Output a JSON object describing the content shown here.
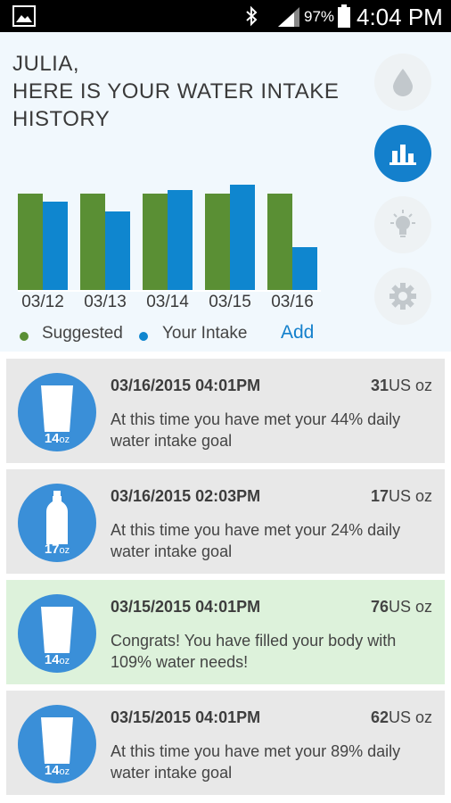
{
  "status_bar": {
    "battery": "97%",
    "time": "4:04 PM"
  },
  "header": {
    "title_line1": "JULIA,",
    "title_line2": "HERE IS YOUR WATER INTAKE",
    "title_line3": "HISTORY"
  },
  "side_nav": [
    {
      "icon": "water-drop-icon",
      "active": false
    },
    {
      "icon": "bar-chart-icon",
      "active": true
    },
    {
      "icon": "lightbulb-icon",
      "active": false
    },
    {
      "icon": "gear-icon",
      "active": false
    }
  ],
  "legend": {
    "suggested": "Suggested",
    "intake": "Your Intake",
    "add": "Add"
  },
  "colors": {
    "suggested": "#5a8f34",
    "intake": "#0f86cf",
    "accent": "#1480cc"
  },
  "chart_data": {
    "type": "bar",
    "categories": [
      "03/12",
      "03/13",
      "03/14",
      "03/15",
      "03/16"
    ],
    "series": [
      {
        "name": "Suggested",
        "values": [
          70,
          70,
          70,
          70,
          70
        ]
      },
      {
        "name": "Your Intake",
        "values": [
          64,
          57,
          72,
          76,
          31
        ]
      }
    ]
  },
  "entries": [
    {
      "date": "03/16/2015 04:01PM",
      "amount": "31",
      "unit": "US oz",
      "oz": "14",
      "oz_unit": "oz",
      "vessel": "glass-icon",
      "message": "At this time you have met your 44% daily water intake goal",
      "highlight": false
    },
    {
      "date": "03/16/2015 02:03PM",
      "amount": "17",
      "unit": "US oz",
      "oz": "17",
      "oz_unit": "oz",
      "vessel": "bottle-icon",
      "message": "At this time you have met your 24% daily water intake goal",
      "highlight": false
    },
    {
      "date": "03/15/2015 04:01PM",
      "amount": "76",
      "unit": "US oz",
      "oz": "14",
      "oz_unit": "oz",
      "vessel": "glass-icon",
      "message": "Congrats! You have filled your body with 109% water needs!",
      "highlight": true
    },
    {
      "date": "03/15/2015 04:01PM",
      "amount": "62",
      "unit": "US oz",
      "oz": "14",
      "oz_unit": "oz",
      "vessel": "glass-icon",
      "message": "At this time you have met your 89% daily water intake goal",
      "highlight": false
    }
  ]
}
